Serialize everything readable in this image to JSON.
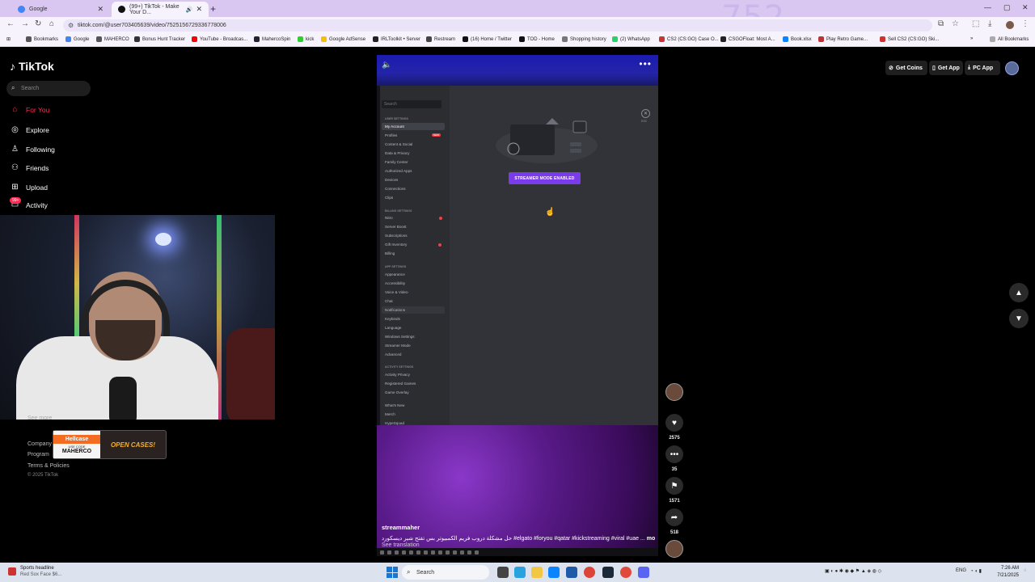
{
  "browser": {
    "tabs": [
      {
        "title": "Google",
        "active": false
      },
      {
        "title": "(99+) TikTok - Make Your D...",
        "active": false
      }
    ],
    "watermark": "752",
    "url": "tiktok.com/@user703405639/video/7525156729336778006",
    "bookmarks": [
      "Bookmarks",
      "Google",
      "MAHERCO",
      "Bonus Hunt Tracker",
      "YouTube - Broadcas...",
      "MahercoSpin",
      "kick",
      "Google AdSense",
      "IRLToolkit • Server",
      "Restream",
      "(16) Home / Twitter",
      "TOD - Home",
      "Shopping history",
      "(2) WhatsApp",
      "CS2 (CS:GO) Case O...",
      "CSGOFloat: Most A...",
      "Book.xlsx",
      "Play Retro Game...",
      "Sell CS2 (CS:GO) Ski..."
    ],
    "all_bookmarks": "All Bookmarks"
  },
  "tiktok": {
    "logo": "TikTok",
    "search_placeholder": "Search",
    "nav": [
      {
        "label": "For You",
        "icon": "home-icon",
        "active": true
      },
      {
        "label": "Explore",
        "icon": "compass-icon",
        "active": false
      },
      {
        "label": "Following",
        "icon": "following-icon",
        "active": false
      },
      {
        "label": "Friends",
        "icon": "friends-icon",
        "active": false
      },
      {
        "label": "Upload",
        "icon": "upload-icon",
        "active": false
      },
      {
        "label": "Activity",
        "icon": "inbox-icon",
        "active": false
      }
    ],
    "activity_badge": "99+",
    "see_more": "See more",
    "footer": {
      "company": "Company",
      "program": "Program",
      "terms": "Terms & Policies",
      "copyright": "© 2025 TikTok"
    },
    "top_right": {
      "coins": "Get Coins",
      "app": "Get App",
      "pc": "PC App"
    }
  },
  "ad": {
    "brand": "Hellcase",
    "code_label": "USE CODE",
    "code": "MAHERCO",
    "cta": "OPEN CASES!"
  },
  "video": {
    "author": "streammaher",
    "caption": "حل مشكلة دروب فريم الكمبيوتر بس تفتح شير ديسكورد #elgato #foryou #qatar #kickstreaming #viral #uae ...",
    "more": "more",
    "see_translation": "See translation",
    "discord": {
      "search_placeholder": "Search",
      "sections": [
        {
          "header": "USER SETTINGS",
          "items": [
            "My Account",
            "Profiles",
            "Content & Social",
            "Data & Privacy",
            "Family Center",
            "Authorized Apps",
            "Devices",
            "Connections",
            "Clips"
          ]
        },
        {
          "header": "BILLING SETTINGS",
          "items": [
            "Nitro",
            "Server Boost",
            "Subscriptions",
            "Gift Inventory",
            "Billing"
          ]
        },
        {
          "header": "APP SETTINGS",
          "items": [
            "Appearance",
            "Accessibility",
            "Voice & Video",
            "Chat",
            "Notifications",
            "Keybinds",
            "Language",
            "Windows Settings",
            "Streamer Mode",
            "Advanced"
          ]
        },
        {
          "header": "ACTIVITY SETTINGS",
          "items": [
            "Activity Privacy",
            "Registered Games",
            "Game Overlay"
          ]
        },
        {
          "header": "",
          "items": [
            "What's New",
            "Merch",
            "HypeSquad"
          ]
        }
      ],
      "new_tag": "NEW",
      "streamer_button": "STREAMER MODE ENABLED",
      "esc": "ESC"
    }
  },
  "actions": {
    "likes": "2575",
    "comments": "35",
    "saves": "1571",
    "shares": "518"
  },
  "taskbar": {
    "news_title": "Sports headline",
    "news_sub": "Red Sox Face $6...",
    "search": "Search",
    "lang": "ENG",
    "time": "7:26 AM",
    "date": "7/21/2025"
  }
}
